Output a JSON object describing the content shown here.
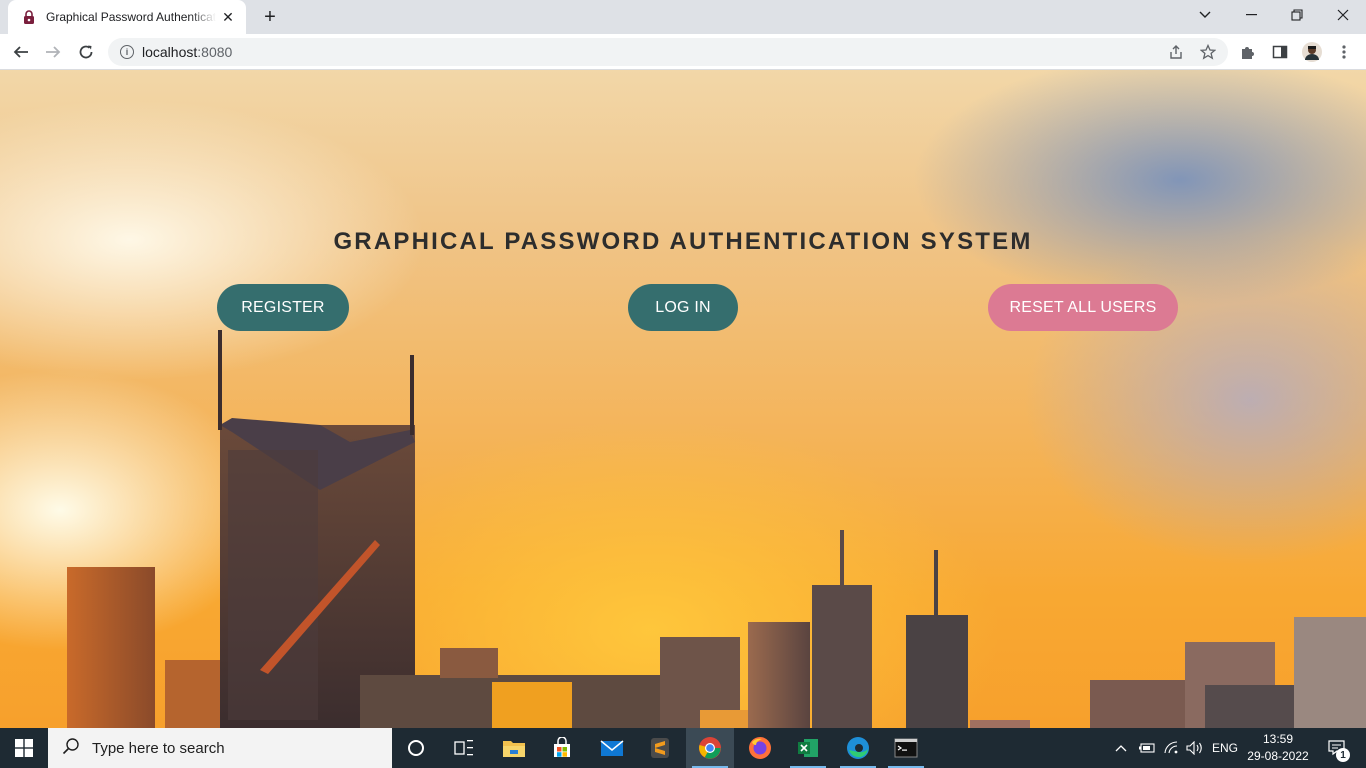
{
  "browser": {
    "tab_title": "Graphical Password Authentication",
    "url_host": "localhost",
    "url_port": ":8080"
  },
  "page": {
    "title": "GRAPHICAL PASSWORD AUTHENTICATION SYSTEM",
    "buttons": {
      "register": "REGISTER",
      "login": "LOG IN",
      "reset": "RESET ALL USERS"
    },
    "colors": {
      "teal_button": "#356e6e",
      "pink_button": "#dc7a93"
    }
  },
  "taskbar": {
    "search_placeholder": "Type here to search",
    "language": "ENG",
    "time": "13:59",
    "date": "29-08-2022",
    "notification_count": "1"
  }
}
